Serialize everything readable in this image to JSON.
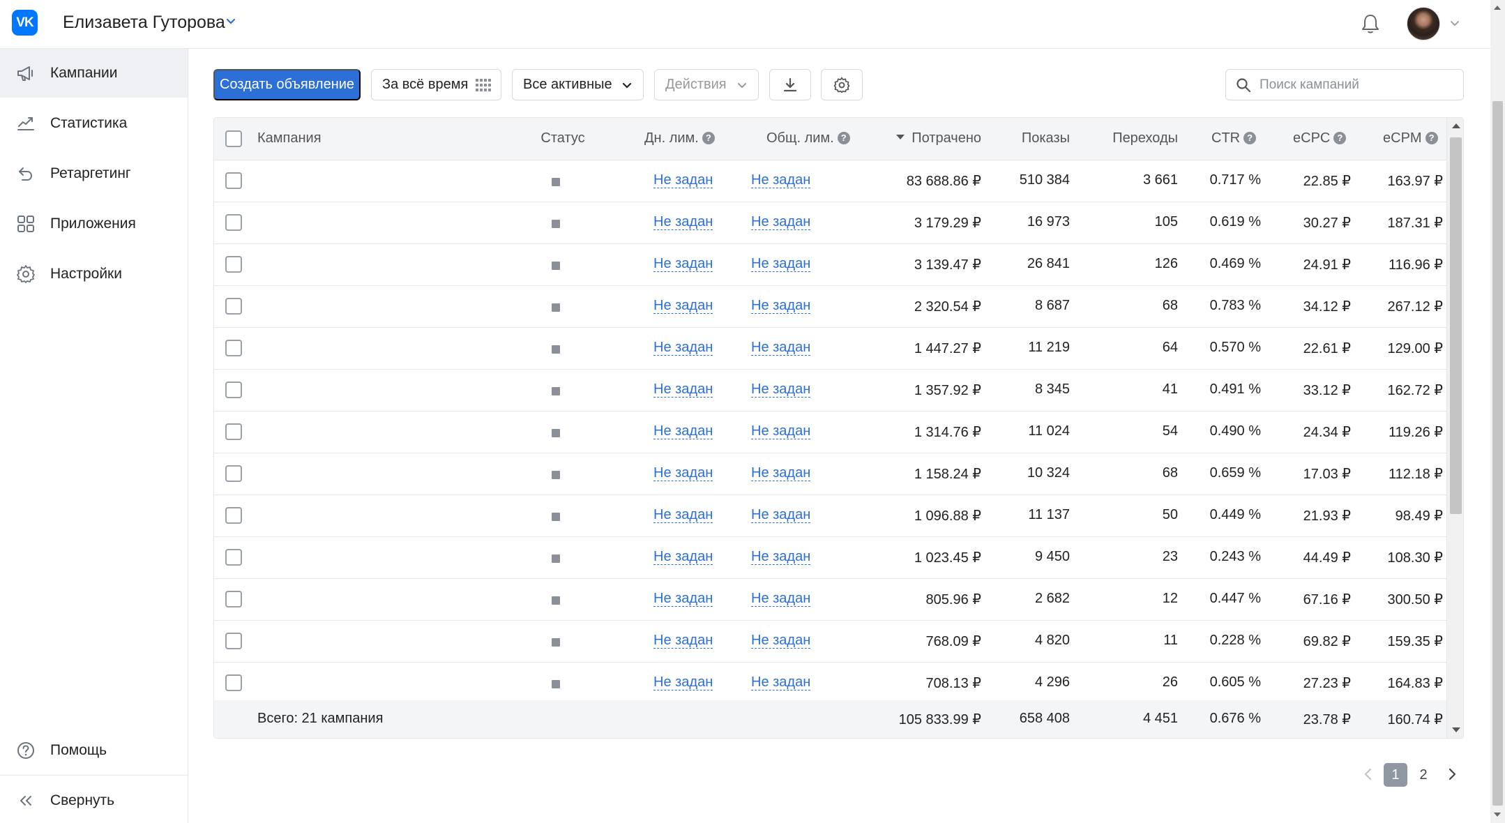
{
  "header": {
    "logo_text": "VK",
    "account_name": "Елизавета Гуторова"
  },
  "sidebar": {
    "items": [
      {
        "label": "Кампании",
        "icon": "megaphone-icon",
        "active": true
      },
      {
        "label": "Статистика",
        "icon": "chart-line-icon",
        "active": false
      },
      {
        "label": "Ретаргетинг",
        "icon": "retarget-arrow-icon",
        "active": false
      },
      {
        "label": "Приложения",
        "icon": "apps-grid-icon",
        "active": false
      },
      {
        "label": "Настройки",
        "icon": "gear-icon",
        "active": false
      }
    ],
    "help_label": "Помощь",
    "collapse_label": "Свернуть"
  },
  "toolbar": {
    "create_label": "Создать объявление",
    "period_label": "За всё время",
    "filter_label": "Все активные",
    "actions_label": "Действия",
    "search_placeholder": "Поиск кампаний"
  },
  "table": {
    "columns": {
      "campaign": "Кампания",
      "status": "Статус",
      "daily_limit": "Дн. лим.",
      "total_limit": "Общ. лим.",
      "spent": "Потрачено",
      "impressions": "Показы",
      "clicks": "Переходы",
      "ctr": "CTR",
      "ecpc": "eCPC",
      "ecpm": "eCPM"
    },
    "rows": [
      {
        "campaign": "",
        "daily_limit": "Не задан",
        "total_limit": "Не задан",
        "spent": "83 688.86 ₽",
        "impressions": "510 384",
        "clicks": "3 661",
        "ctr": "0.717 %",
        "ecpc": "22.85 ₽",
        "ecpm": "163.97 ₽"
      },
      {
        "campaign": "",
        "daily_limit": "Не задан",
        "total_limit": "Не задан",
        "spent": "3 179.29 ₽",
        "impressions": "16 973",
        "clicks": "105",
        "ctr": "0.619 %",
        "ecpc": "30.27 ₽",
        "ecpm": "187.31 ₽"
      },
      {
        "campaign": "",
        "daily_limit": "Не задан",
        "total_limit": "Не задан",
        "spent": "3 139.47 ₽",
        "impressions": "26 841",
        "clicks": "126",
        "ctr": "0.469 %",
        "ecpc": "24.91 ₽",
        "ecpm": "116.96 ₽"
      },
      {
        "campaign": "",
        "daily_limit": "Не задан",
        "total_limit": "Не задан",
        "spent": "2 320.54 ₽",
        "impressions": "8 687",
        "clicks": "68",
        "ctr": "0.783 %",
        "ecpc": "34.12 ₽",
        "ecpm": "267.12 ₽"
      },
      {
        "campaign": "",
        "daily_limit": "Не задан",
        "total_limit": "Не задан",
        "spent": "1 447.27 ₽",
        "impressions": "11 219",
        "clicks": "64",
        "ctr": "0.570 %",
        "ecpc": "22.61 ₽",
        "ecpm": "129.00 ₽"
      },
      {
        "campaign": "",
        "daily_limit": "Не задан",
        "total_limit": "Не задан",
        "spent": "1 357.92 ₽",
        "impressions": "8 345",
        "clicks": "41",
        "ctr": "0.491 %",
        "ecpc": "33.12 ₽",
        "ecpm": "162.72 ₽"
      },
      {
        "campaign": "",
        "daily_limit": "Не задан",
        "total_limit": "Не задан",
        "spent": "1 314.76 ₽",
        "impressions": "11 024",
        "clicks": "54",
        "ctr": "0.490 %",
        "ecpc": "24.34 ₽",
        "ecpm": "119.26 ₽"
      },
      {
        "campaign": "",
        "daily_limit": "Не задан",
        "total_limit": "Не задан",
        "spent": "1 158.24 ₽",
        "impressions": "10 324",
        "clicks": "68",
        "ctr": "0.659 %",
        "ecpc": "17.03 ₽",
        "ecpm": "112.18 ₽"
      },
      {
        "campaign": "",
        "daily_limit": "Не задан",
        "total_limit": "Не задан",
        "spent": "1 096.88 ₽",
        "impressions": "11 137",
        "clicks": "50",
        "ctr": "0.449 %",
        "ecpc": "21.93 ₽",
        "ecpm": "98.49 ₽"
      },
      {
        "campaign": "",
        "daily_limit": "Не задан",
        "total_limit": "Не задан",
        "spent": "1 023.45 ₽",
        "impressions": "9 450",
        "clicks": "23",
        "ctr": "0.243 %",
        "ecpc": "44.49 ₽",
        "ecpm": "108.30 ₽"
      },
      {
        "campaign": "",
        "daily_limit": "Не задан",
        "total_limit": "Не задан",
        "spent": "805.96 ₽",
        "impressions": "2 682",
        "clicks": "12",
        "ctr": "0.447 %",
        "ecpc": "67.16 ₽",
        "ecpm": "300.50 ₽"
      },
      {
        "campaign": "",
        "daily_limit": "Не задан",
        "total_limit": "Не задан",
        "spent": "768.09 ₽",
        "impressions": "4 820",
        "clicks": "11",
        "ctr": "0.228 %",
        "ecpc": "69.82 ₽",
        "ecpm": "159.35 ₽"
      },
      {
        "campaign": "",
        "daily_limit": "Не задан",
        "total_limit": "Не задан",
        "spent": "708.13 ₽",
        "impressions": "4 296",
        "clicks": "26",
        "ctr": "0.605 %",
        "ecpc": "27.23 ₽",
        "ecpm": "164.83 ₽"
      }
    ],
    "totals": {
      "label": "Всего: 21 кампания",
      "spent": "105 833.99 ₽",
      "impressions": "658 408",
      "clicks": "4 451",
      "ctr": "0.676 %",
      "ecpc": "23.78 ₽",
      "ecpm": "160.74 ₽"
    }
  },
  "pagination": {
    "pages": [
      "1",
      "2"
    ],
    "current": "1"
  },
  "colors": {
    "primary": "#2c6fd6",
    "vk_blue": "#0077ff",
    "active_nav_bg": "#eef0f4"
  }
}
